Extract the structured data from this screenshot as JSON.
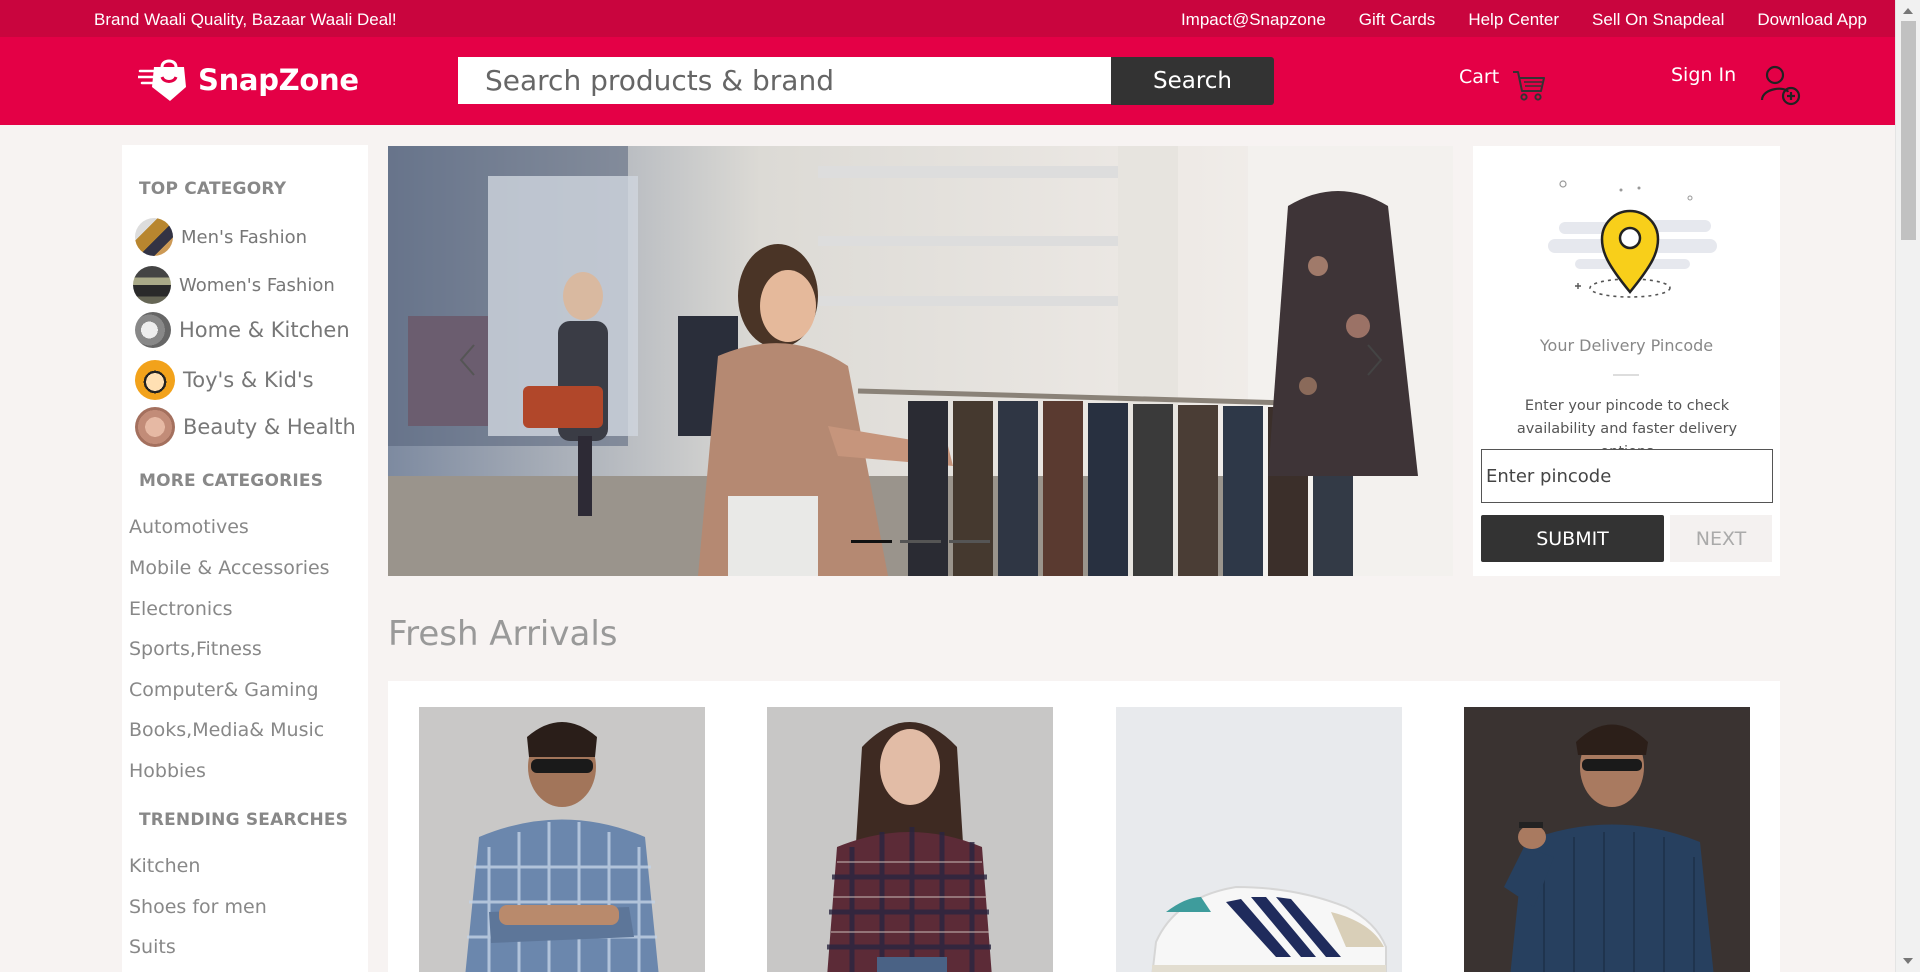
{
  "topbar": {
    "tagline": "Brand Waali Quality, Bazaar Waali Deal!",
    "links": [
      "Impact@Snapzone",
      "Gift Cards",
      "Help Center",
      "Sell On Snapdeal",
      "Download App"
    ]
  },
  "header": {
    "brand": "SnapZone",
    "search_placeholder": "Search products & brand",
    "search_button": "Search",
    "cart_label": "Cart",
    "signin_label": "Sign In"
  },
  "sidebar": {
    "top_category_heading": "TOP CATEGORY",
    "top_categories": [
      {
        "label": "Men's Fashion",
        "icon": "mens-fashion-thumb"
      },
      {
        "label": "Women's Fashion",
        "icon": "womens-fashion-thumb"
      },
      {
        "label": "Home & Kitchen",
        "icon": "home-kitchen-thumb"
      },
      {
        "label": "Toy's & Kid's",
        "icon": "toys-kids-thumb"
      },
      {
        "label": "Beauty & Health",
        "icon": "beauty-health-thumb"
      }
    ],
    "more_categories_heading": "MORE CATEGORIES",
    "more_categories": [
      "Automotives",
      "Mobile & Accessories",
      "Electronics",
      "Sports,Fitness",
      "Computer& Gaming",
      "Books,Media& Music",
      "Hobbies"
    ],
    "trending_heading": "TRENDING SEARCHES",
    "trending": [
      "Kitchen",
      "Shoes for men",
      "Suits"
    ]
  },
  "banner": {
    "slide_count": 3,
    "active_slide": 1
  },
  "pincode": {
    "title": "Your Delivery Pincode",
    "description": "Enter your pincode to check availability and faster delivery options",
    "input_placeholder": "Enter pincode",
    "submit_label": "SUBMIT",
    "next_label": "NEXT"
  },
  "fresh_arrivals": {
    "title": "Fresh Arrivals",
    "products": [
      "blue-check-shirt-man",
      "red-plaid-shirt-woman",
      "white-sneaker",
      "navy-shirt-man"
    ]
  },
  "colors": {
    "topbar": "#c9053e",
    "header": "#e40046",
    "dark_button": "#333333",
    "page_bg": "#f7f3f2"
  }
}
